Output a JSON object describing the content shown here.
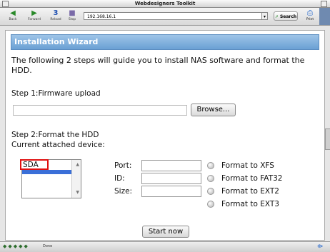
{
  "window": {
    "title": "Webdesigners Toolkit"
  },
  "toolbar": {
    "back_label": "Back",
    "forward_label": "Forward",
    "reload_label": "Reload",
    "stop_label": "Stop",
    "address": "192.168.16.1",
    "search_label": "Search",
    "print_label": "Print"
  },
  "wizard": {
    "title": "Installation Wizard",
    "intro": "The following 2 steps will guide you to install NAS software and format the HDD.",
    "step1_label": "Step 1:Firmware upload",
    "browse_label": "Browse...",
    "step2_label": "Step 2:Format the HDD",
    "device_label": "Current attached device:",
    "device_selected": "SDA",
    "port_label": "Port:",
    "id_label": "ID:",
    "size_label": "Size:",
    "format_options": [
      "Format to XFS",
      "Format to FAT32",
      "Format to EXT2",
      "Format to EXT3"
    ],
    "start_label": "Start now"
  },
  "status": {
    "text": "Done"
  },
  "icons": [
    "back-icon",
    "forward-icon",
    "reload-icon",
    "stop-icon",
    "search-icon",
    "print-icon"
  ]
}
